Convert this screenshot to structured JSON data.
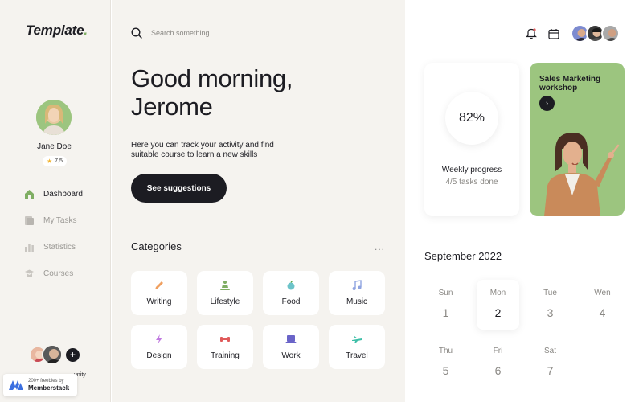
{
  "brand": {
    "logo_text": "Template",
    "logo_dot": "."
  },
  "profile": {
    "name": "Jane Doe",
    "rating": "7,5"
  },
  "nav": [
    {
      "label": "Dashboard",
      "icon": "home-icon",
      "active": true
    },
    {
      "label": "My Tasks",
      "icon": "tasks-icon",
      "active": false
    },
    {
      "label": "Statistics",
      "icon": "chart-icon",
      "active": false
    },
    {
      "label": "Courses",
      "icon": "courses-icon",
      "active": false
    }
  ],
  "community": {
    "label": "unity"
  },
  "badge": {
    "line1": "200+ freebies by",
    "line2": "Memberstack"
  },
  "search": {
    "placeholder": "Search something..."
  },
  "greeting": {
    "line1": "Good morning,",
    "line2": "Jerome",
    "subtitle": "Here you can track your activity and find suitable course to learn a new skills"
  },
  "cta": {
    "label": "See suggestions"
  },
  "categories": {
    "title": "Categories",
    "more": "...",
    "items": [
      {
        "label": "Writing",
        "icon": "pencil-icon",
        "color": "#f0a060"
      },
      {
        "label": "Lifestyle",
        "icon": "meditation-icon",
        "color": "#7fae63"
      },
      {
        "label": "Food",
        "icon": "apple-icon",
        "color": "#6cc3c9"
      },
      {
        "label": "Music",
        "icon": "music-note-icon",
        "color": "#8fa4e0"
      },
      {
        "label": "Design",
        "icon": "lightning-icon",
        "color": "#c07ae0"
      },
      {
        "label": "Training",
        "icon": "dumbbell-icon",
        "color": "#e05a5a"
      },
      {
        "label": "Work",
        "icon": "laptop-icon",
        "color": "#6a64c8"
      },
      {
        "label": "Travel",
        "icon": "plane-icon",
        "color": "#3fbfa8"
      }
    ]
  },
  "progress": {
    "value": "82%",
    "title": "Weekly progress",
    "subtitle": "4/5 tasks done"
  },
  "workshop": {
    "title": "Sales Marketing workshop",
    "button": "›"
  },
  "calendar": {
    "title": "September 2022",
    "days": [
      {
        "name": "Sun",
        "date": "1",
        "selected": false
      },
      {
        "name": "Mon",
        "date": "2",
        "selected": true
      },
      {
        "name": "Tue",
        "date": "3",
        "selected": false
      },
      {
        "name": "Wen",
        "date": "4",
        "selected": false
      },
      {
        "name": "Thu",
        "date": "5",
        "selected": false
      },
      {
        "name": "Fri",
        "date": "6",
        "selected": false
      },
      {
        "name": "Sat",
        "date": "7",
        "selected": false
      }
    ]
  },
  "colors": {
    "accent_green": "#9cc57f",
    "dark": "#1c1c22",
    "background": "#f5f3ef"
  }
}
